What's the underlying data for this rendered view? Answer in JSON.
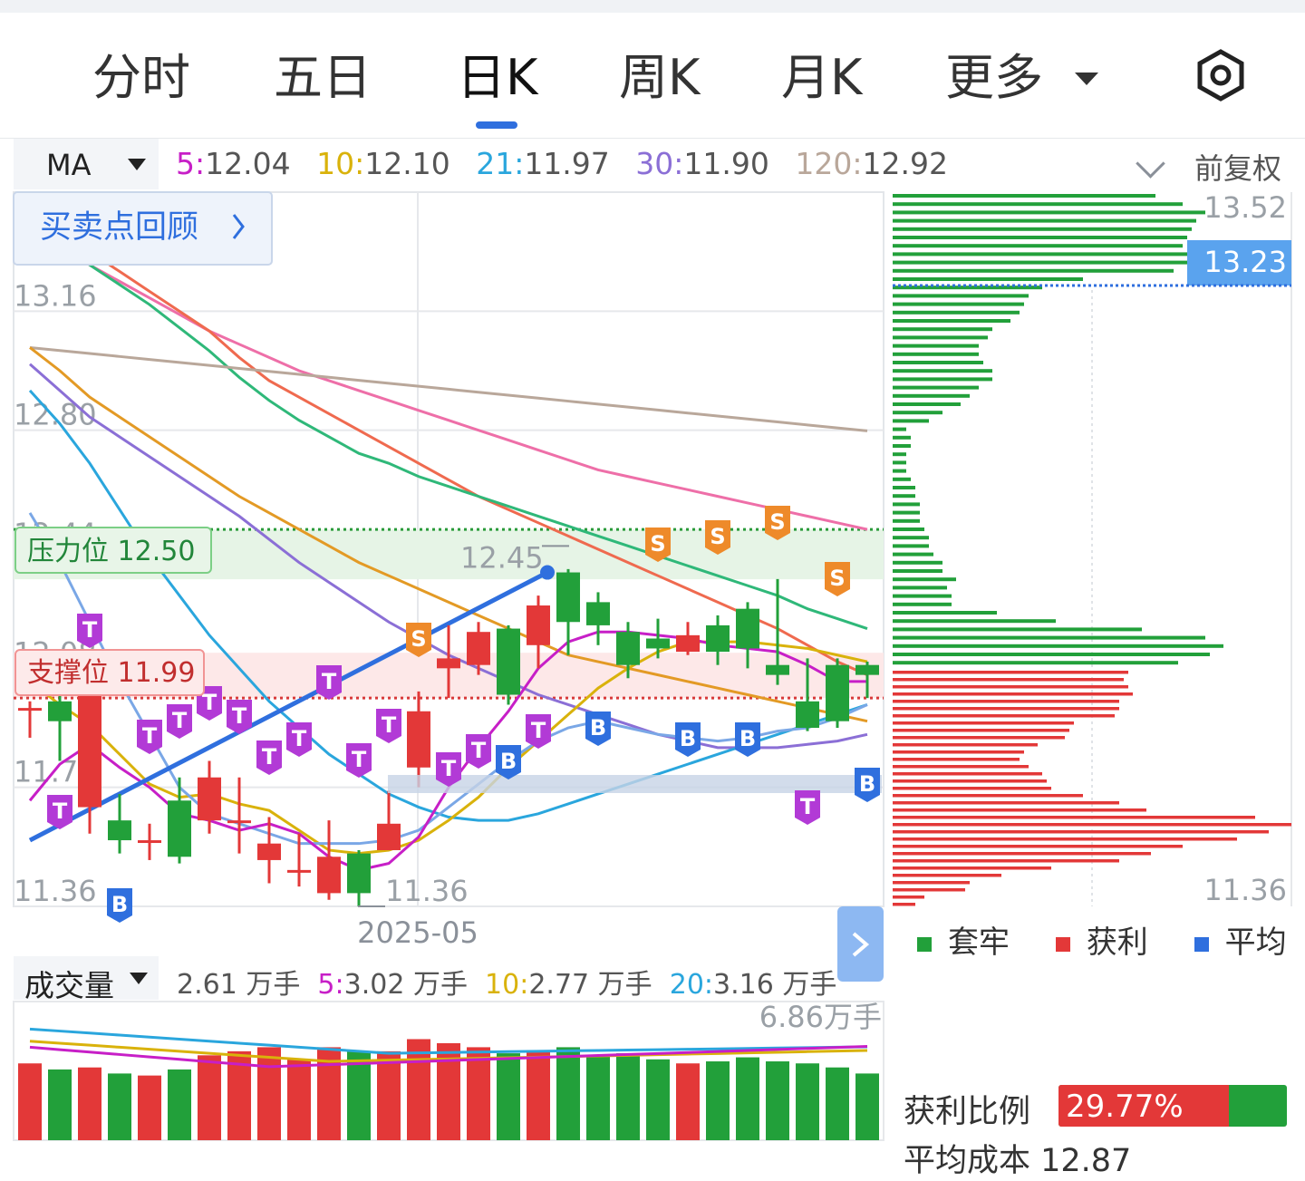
{
  "tabs": [
    {
      "label": "分时",
      "active": false
    },
    {
      "label": "五日",
      "active": false
    },
    {
      "label": "日K",
      "active": true
    },
    {
      "label": "周K",
      "active": false
    },
    {
      "label": "月K",
      "active": false
    },
    {
      "label": "更多",
      "active": false
    }
  ],
  "settings_icon": "settings-hexagon-icon",
  "ma_bar": {
    "selector": "MA",
    "items": [
      {
        "key": "5:",
        "value": "12.04",
        "color": "#c71fc7"
      },
      {
        "key": "10:",
        "value": "12.10",
        "color": "#d9b20b"
      },
      {
        "key": "21:",
        "value": "11.97",
        "color": "#2aa6dd"
      },
      {
        "key": "30:",
        "value": "11.90",
        "color": "#8b6fd6"
      },
      {
        "key": "120:",
        "value": "12.92",
        "color": "#b9a79a"
      }
    ],
    "adjust": "前复权"
  },
  "review_button": "买卖点回顾",
  "pressure": "压力位 12.50",
  "support": "支撑位 11.99",
  "vol_bar": {
    "selector": "成交量",
    "current": "2.61 万手",
    "items": [
      {
        "key": "5:",
        "value": "3.02 万手",
        "color": "#c71fc7"
      },
      {
        "key": "10:",
        "value": "2.77 万手",
        "color": "#d9b20b"
      },
      {
        "key": "20:",
        "value": "3.16 万手",
        "color": "#2aa6dd"
      }
    ],
    "max_label": "6.86万手"
  },
  "legend": [
    {
      "label": "套牢",
      "color": "#22a03a"
    },
    {
      "label": "获利",
      "color": "#e33838"
    },
    {
      "label": "平均",
      "color": "#2f6fde"
    }
  ],
  "profit": {
    "label": "获利比例",
    "value": "29.77%",
    "ratio": 0.2977
  },
  "avg_cost": "平均成本 12.87",
  "chart_data": {
    "type": "candlestick",
    "ylim": [
      11.36,
      13.52
    ],
    "y_ticks": [
      "13.16",
      "12.80",
      "12.44",
      "12.08",
      "11.72",
      "11.36"
    ],
    "x_label": "2025-05",
    "high_label": "12.45",
    "low_label": "11.36",
    "pressure_level": 12.5,
    "support_level": 11.99,
    "candles": [
      {
        "o": 11.96,
        "c": 11.96,
        "h": 11.98,
        "l": 11.87
      },
      {
        "o": 11.98,
        "c": 11.92,
        "h": 12.03,
        "l": 11.8
      },
      {
        "o": 11.66,
        "c": 12.0,
        "h": 12.05,
        "l": 11.58
      },
      {
        "o": 11.62,
        "c": 11.56,
        "h": 11.7,
        "l": 11.52
      },
      {
        "o": 11.56,
        "c": 11.56,
        "h": 11.61,
        "l": 11.5
      },
      {
        "o": 11.68,
        "c": 11.51,
        "h": 11.75,
        "l": 11.49
      },
      {
        "o": 11.62,
        "c": 11.75,
        "h": 11.8,
        "l": 11.58
      },
      {
        "o": 11.62,
        "c": 11.62,
        "h": 11.75,
        "l": 11.52
      },
      {
        "o": 11.5,
        "c": 11.55,
        "h": 11.63,
        "l": 11.43
      },
      {
        "o": 11.47,
        "c": 11.47,
        "h": 11.58,
        "l": 11.42
      },
      {
        "o": 11.4,
        "c": 11.51,
        "h": 11.62,
        "l": 11.38
      },
      {
        "o": 11.52,
        "c": 11.4,
        "h": 11.53,
        "l": 11.36
      },
      {
        "o": 11.53,
        "c": 11.61,
        "h": 11.71,
        "l": 11.53
      },
      {
        "o": 11.78,
        "c": 11.95,
        "h": 12.01,
        "l": 11.72
      },
      {
        "o": 12.08,
        "c": 12.11,
        "h": 12.21,
        "l": 11.99
      },
      {
        "o": 12.09,
        "c": 12.19,
        "h": 12.22,
        "l": 12.06
      },
      {
        "o": 12.2,
        "c": 12.0,
        "h": 12.21,
        "l": 11.97
      },
      {
        "o": 12.15,
        "c": 12.27,
        "h": 12.3,
        "l": 12.08
      },
      {
        "o": 12.37,
        "c": 12.22,
        "h": 12.38,
        "l": 12.12
      },
      {
        "o": 12.28,
        "c": 12.21,
        "h": 12.31,
        "l": 12.15
      },
      {
        "o": 12.19,
        "c": 12.09,
        "h": 12.22,
        "l": 12.05
      },
      {
        "o": 12.17,
        "c": 12.14,
        "h": 12.23,
        "l": 12.11
      },
      {
        "o": 12.13,
        "c": 12.18,
        "h": 12.22,
        "l": 12.12
      },
      {
        "o": 12.21,
        "c": 12.13,
        "h": 12.24,
        "l": 12.09
      },
      {
        "o": 12.26,
        "c": 12.14,
        "h": 12.28,
        "l": 12.08
      },
      {
        "o": 12.09,
        "c": 12.06,
        "h": 12.35,
        "l": 12.03
      },
      {
        "o": 11.98,
        "c": 11.9,
        "h": 12.11,
        "l": 11.89
      },
      {
        "o": 12.09,
        "c": 11.92,
        "h": 12.11,
        "l": 11.9
      },
      {
        "o": 12.09,
        "c": 12.06,
        "h": 12.1,
        "l": 11.99
      }
    ],
    "ma5": [
      11.68,
      11.79,
      11.85,
      11.78,
      11.72,
      11.64,
      11.62,
      11.59,
      11.61,
      11.58,
      11.51,
      11.47,
      11.49,
      11.57,
      11.72,
      11.84,
      11.95,
      12.08,
      12.16,
      12.19,
      12.19,
      12.18,
      12.17,
      12.15,
      12.14,
      12.13,
      12.09,
      12.04,
      12.04
    ],
    "ma10": [
      12.04,
      11.97,
      11.91,
      11.82,
      11.73,
      11.69,
      11.7,
      11.67,
      11.65,
      11.59,
      11.53,
      11.52,
      11.53,
      11.56,
      11.62,
      11.69,
      11.78,
      11.86,
      11.94,
      12.02,
      12.08,
      12.13,
      12.16,
      12.16,
      12.16,
      12.15,
      12.14,
      12.12,
      12.1
    ],
    "ma21": [
      12.55,
      12.4,
      12.22,
      12.04,
      11.88,
      11.72,
      11.64,
      11.61,
      11.58,
      11.55,
      11.55,
      11.55,
      11.56,
      11.59,
      11.66,
      11.73,
      11.8,
      11.86,
      11.9,
      11.92,
      11.9,
      11.88,
      11.87,
      11.86,
      11.87,
      11.89,
      11.9,
      11.93,
      11.97
    ],
    "ma30": [
      12.32,
      12.24,
      12.14,
      12.04,
      11.92,
      11.82,
      11.75,
      11.66,
      11.58,
      11.53,
      11.5,
      11.51,
      11.54,
      11.61,
      11.7,
      11.8,
      11.89,
      11.96,
      12.04,
      12.11,
      12.16,
      12.18,
      12.17,
      12.15,
      12.13,
      12.11,
      12.07,
      12.02,
      11.98
    ],
    "ma_mid": [
      12.72,
      12.6,
      12.48,
      12.36,
      12.26,
      12.18,
      12.12,
      12.06,
      12.02,
      11.98,
      11.94,
      11.92,
      11.92,
      11.91,
      11.92,
      11.93,
      11.95,
      11.98,
      12.01,
      12.04,
      12.05,
      12.05,
      12.04,
      12.02,
      12.0,
      11.98,
      11.96,
      11.94,
      11.92
    ]
  },
  "chip_distribution": {
    "current": "13.23",
    "top": "13.52",
    "bottom": "11.36"
  },
  "volume_data": [
    3.8,
    3.5,
    3.6,
    3.3,
    3.2,
    3.5,
    4.2,
    4.4,
    4.6,
    4.0,
    4.6,
    4.4,
    4.4,
    5.0,
    4.8,
    4.6,
    4.3,
    4.4,
    4.6,
    4.2,
    4.3,
    4.0,
    3.8,
    3.9,
    4.1,
    3.9,
    3.8,
    3.6,
    3.3
  ]
}
